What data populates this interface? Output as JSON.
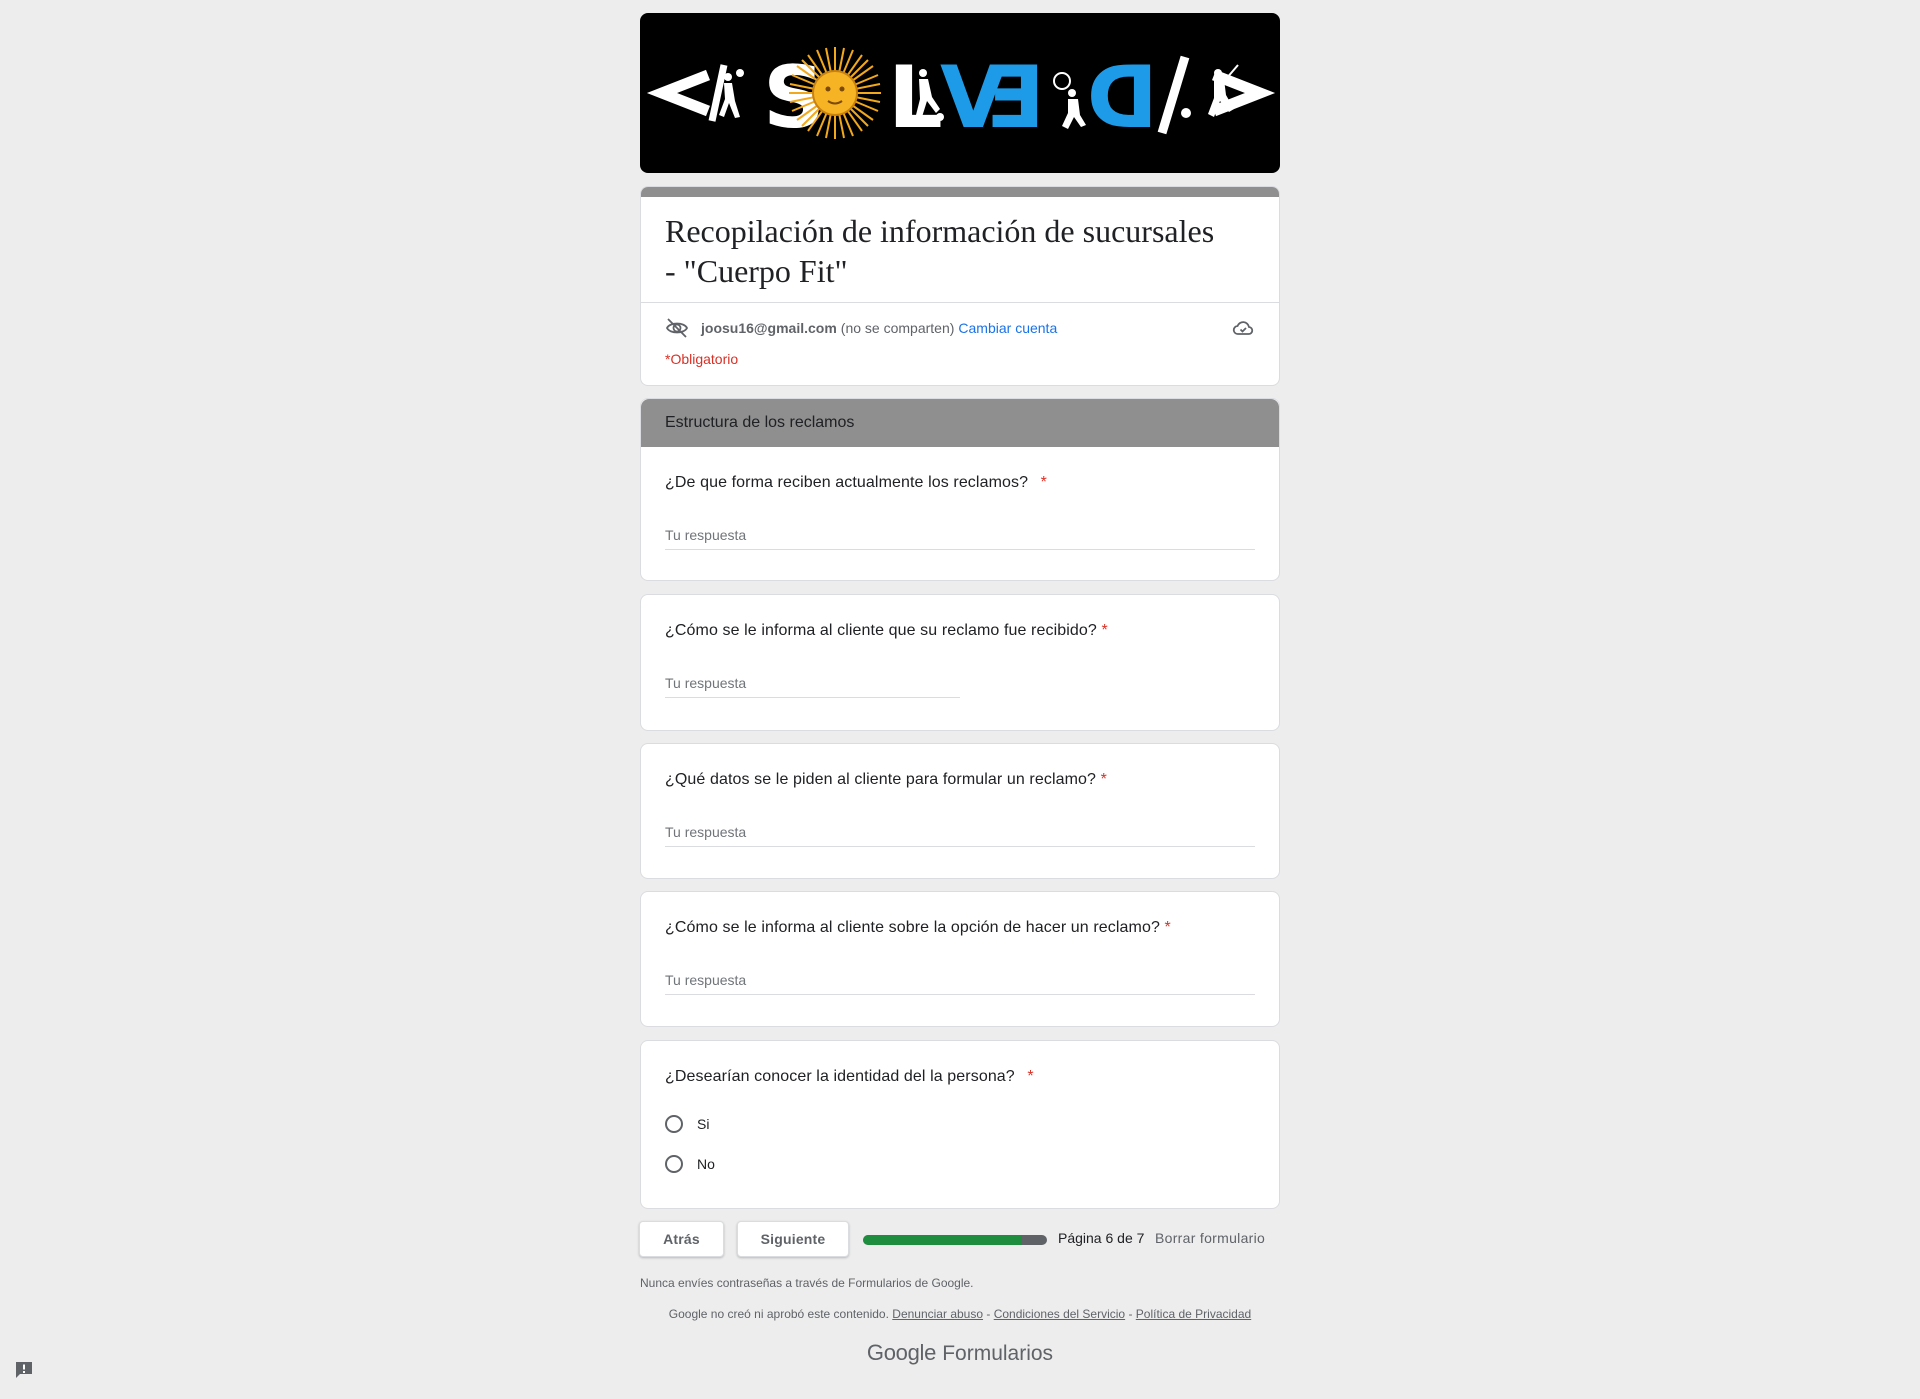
{
  "banner": {
    "logo_text": "</SOLVED/>",
    "colors": {
      "background": "#000000",
      "white": "#ffffff",
      "blue": "#1e9be8",
      "sun": "#f2a81d"
    }
  },
  "header": {
    "title": "Recopilación de información de sucursales - \"Cuerpo Fit\"",
    "account_email": "joosu16@gmail.com",
    "not_shared": "(no se comparten)",
    "switch_account": "Cambiar cuenta",
    "required_note": "*Obligatorio",
    "icons": [
      "eye-off-icon",
      "cloud-icon"
    ]
  },
  "section": {
    "title": "Estructura de los reclamos"
  },
  "questions": [
    {
      "title": "¿De que forma reciben actualmente los reclamos?",
      "required": "*",
      "placeholder": "Tu respuesta"
    },
    {
      "title": "¿Cómo se le informa al cliente que su reclamo fue recibido?",
      "required": "*",
      "placeholder": "Tu respuesta"
    },
    {
      "title": "¿Qué datos se le piden al cliente para formular un reclamo?",
      "required": "*",
      "placeholder": "Tu respuesta"
    },
    {
      "title": "¿Cómo se le informa al cliente sobre la opción de hacer un reclamo?",
      "required": "*",
      "placeholder": "Tu respuesta"
    },
    {
      "title": "¿Desearían conocer la identidad del la persona?",
      "required": "*",
      "options": [
        "Si",
        "No"
      ]
    }
  ],
  "nav": {
    "back": "Atrás",
    "next": "Siguiente",
    "progress_fraction": 0.857,
    "page_label": "Página 6 de 7",
    "clear": "Borrar formulario"
  },
  "footer": {
    "password_note": "Nunca envíes contraseñas a través de Formularios de Google.",
    "disclaimer": "Google no creó ni aprobó este contenido.",
    "report_abuse": "Denunciar abuso",
    "terms": "Condiciones del Servicio",
    "privacy": "Política de Privacidad",
    "separator": "-",
    "brand_google": "Google",
    "brand_product": "Formularios"
  },
  "colors": {
    "accent_gray": "#8f8f8f",
    "required_red": "#d93025",
    "link_blue": "#1a73e8",
    "progress_green": "#1e8e3e"
  }
}
